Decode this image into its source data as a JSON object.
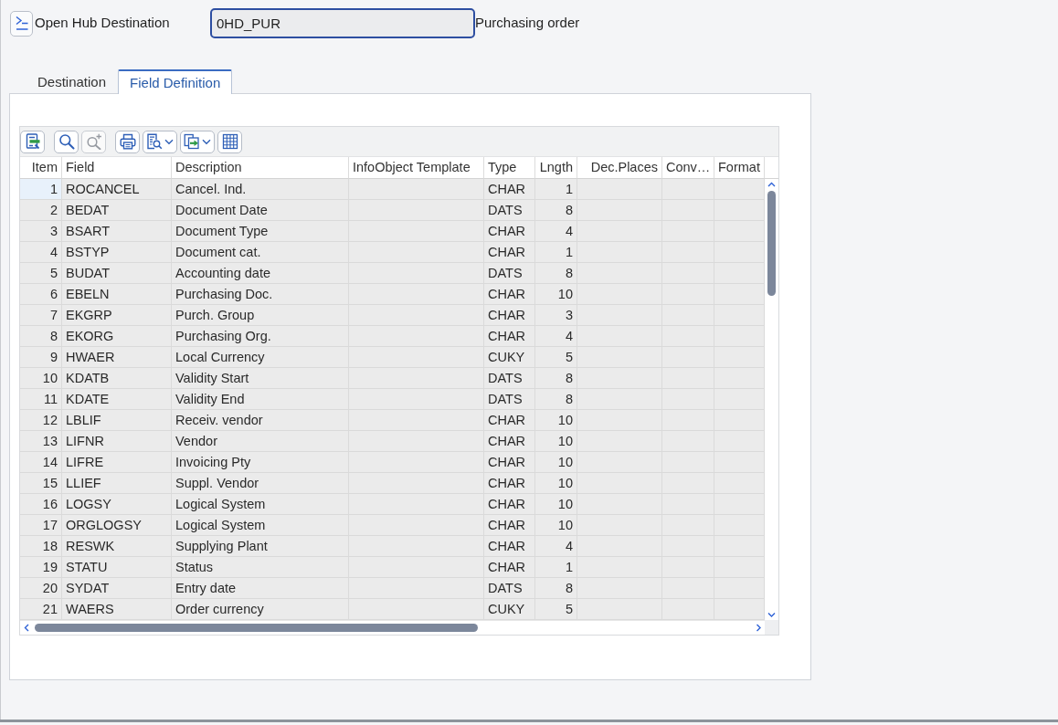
{
  "header": {
    "label": "Open Hub Destination",
    "field": {
      "value": "0HD_PUR",
      "focused": true
    },
    "description": "Purchasing order"
  },
  "tabs": [
    {
      "label": "Destination",
      "selected": false
    },
    {
      "label": "Field Definition",
      "selected": true
    }
  ],
  "toolbar": [
    [
      {
        "kind": "details",
        "disabled": false,
        "menu": false
      }
    ],
    [
      {
        "kind": "find",
        "disabled": false,
        "menu": false
      },
      {
        "kind": "find-next",
        "disabled": true,
        "menu": false
      }
    ],
    [
      {
        "kind": "print",
        "disabled": false,
        "menu": false
      },
      {
        "kind": "view",
        "disabled": false,
        "menu": true
      },
      {
        "kind": "export",
        "disabled": false,
        "menu": true
      },
      {
        "kind": "layout",
        "disabled": false,
        "menu": false
      }
    ]
  ],
  "table": {
    "columns": [
      {
        "label": "Item",
        "kind": "number"
      },
      {
        "label": "Field",
        "kind": "text"
      },
      {
        "label": "Description",
        "kind": "text"
      },
      {
        "label": "InfoObject Template",
        "kind": "text"
      },
      {
        "label": "Type",
        "kind": "text"
      },
      {
        "label": "Lngth",
        "kind": "number"
      },
      {
        "label": "Dec.Places",
        "kind": "number"
      },
      {
        "label": "Conv…",
        "kind": "text"
      },
      {
        "label": "Format",
        "kind": "text"
      }
    ],
    "rows": [
      {
        "item": "1",
        "field": "ROCANCEL",
        "description": "Cancel. Ind.",
        "type": "CHAR",
        "lngth": "1",
        "selected": true
      },
      {
        "item": "2",
        "field": "BEDAT",
        "description": "Document Date",
        "type": "DATS",
        "lngth": "8",
        "selected": false
      },
      {
        "item": "3",
        "field": "BSART",
        "description": "Document Type",
        "type": "CHAR",
        "lngth": "4",
        "selected": false
      },
      {
        "item": "4",
        "field": "BSTYP",
        "description": "Document cat.",
        "type": "CHAR",
        "lngth": "1",
        "selected": false
      },
      {
        "item": "5",
        "field": "BUDAT",
        "description": "Accounting date",
        "type": "DATS",
        "lngth": "8",
        "selected": false
      },
      {
        "item": "6",
        "field": "EBELN",
        "description": "Purchasing Doc.",
        "type": "CHAR",
        "lngth": "10",
        "selected": false
      },
      {
        "item": "7",
        "field": "EKGRP",
        "description": "Purch. Group",
        "type": "CHAR",
        "lngth": "3",
        "selected": false
      },
      {
        "item": "8",
        "field": "EKORG",
        "description": "Purchasing Org.",
        "type": "CHAR",
        "lngth": "4",
        "selected": false
      },
      {
        "item": "9",
        "field": "HWAER",
        "description": "Local Currency",
        "type": "CUKY",
        "lngth": "5",
        "selected": false
      },
      {
        "item": "10",
        "field": "KDATB",
        "description": "Validity Start",
        "type": "DATS",
        "lngth": "8",
        "selected": false
      },
      {
        "item": "11",
        "field": "KDATE",
        "description": "Validity End",
        "type": "DATS",
        "lngth": "8",
        "selected": false
      },
      {
        "item": "12",
        "field": "LBLIF",
        "description": "Receiv. vendor",
        "type": "CHAR",
        "lngth": "10",
        "selected": false
      },
      {
        "item": "13",
        "field": "LIFNR",
        "description": "Vendor",
        "type": "CHAR",
        "lngth": "10",
        "selected": false
      },
      {
        "item": "14",
        "field": "LIFRE",
        "description": "Invoicing Pty",
        "type": "CHAR",
        "lngth": "10",
        "selected": false
      },
      {
        "item": "15",
        "field": "LLIEF",
        "description": "Suppl. Vendor",
        "type": "CHAR",
        "lngth": "10",
        "selected": false
      },
      {
        "item": "16",
        "field": "LOGSY",
        "description": "Logical System",
        "type": "CHAR",
        "lngth": "10",
        "selected": false
      },
      {
        "item": "17",
        "field": "ORGLOGSY",
        "description": "Logical System",
        "type": "CHAR",
        "lngth": "10",
        "selected": false
      },
      {
        "item": "18",
        "field": "RESWK",
        "description": "Supplying Plant",
        "type": "CHAR",
        "lngth": "4",
        "selected": false
      },
      {
        "item": "19",
        "field": "STATU",
        "description": "Status",
        "type": "CHAR",
        "lngth": "1",
        "selected": false
      },
      {
        "item": "20",
        "field": "SYDAT",
        "description": "Entry date",
        "type": "DATS",
        "lngth": "8",
        "selected": false
      },
      {
        "item": "21",
        "field": "WAERS",
        "description": "Order currency",
        "type": "CUKY",
        "lngth": "5",
        "selected": false
      }
    ]
  }
}
